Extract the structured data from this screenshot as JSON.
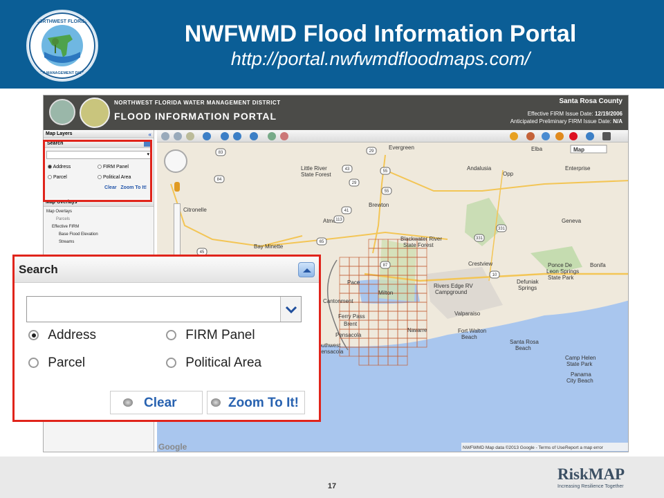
{
  "slide": {
    "title": "NWFWMD Flood Information Portal",
    "url": "http://portal.nwfwmdfloodmaps.com/",
    "page_number": "17"
  },
  "logo": {
    "text_top": "NORTHWEST FLORIDA",
    "text_bottom": "WATER MANAGEMENT DISTRICT"
  },
  "app_header": {
    "district": "NORTHWEST FLORIDA WATER MANAGEMENT DISTRICT",
    "portal": "FLOOD INFORMATION PORTAL",
    "county": "Santa Rosa County",
    "effective_label": "Effective FIRM Issue Date:",
    "effective_value": "12/19/2006",
    "anticipated_label": "Anticipated Preliminary FIRM Issue Date:",
    "anticipated_value": "N/A"
  },
  "sidebar": {
    "map_layers": "Map Layers",
    "search": "Search",
    "radio_address": "Address",
    "radio_firm": "FIRM Panel",
    "radio_parcel": "Parcel",
    "radio_political": "Political Area",
    "clear": "Clear",
    "zoom": "Zoom To It!",
    "map_overlays": "Map Overlays",
    "tree": [
      "Map Overlays",
      "Parcels",
      "Effective FIRM",
      "Base Flood Elevation",
      "Streams"
    ]
  },
  "map": {
    "type_select": "Map",
    "attribution": "NWFWMD Map data ©2013 Google - Terms of Use",
    "report": "Report a map error",
    "google": "Google",
    "labels": {
      "evergreen": "Evergreen",
      "elba": "Elba",
      "andalusia": "Andalusia",
      "opp": "Opp",
      "enterprise": "Enterprise",
      "little_river": "Little River",
      "state_forest": "State Forest",
      "brewton": "Brewton",
      "citronelle": "Citronelle",
      "atmore": "Atmore",
      "geneva": "Geneva",
      "bay_minette": "Bay Minette",
      "blackwater": "Blackwater River",
      "blackwater2": "State Forest",
      "crestview": "Crestview",
      "defuniak": "Defuniak",
      "defuniak2": "Springs",
      "ponce": "Ponce De",
      "ponce2": "Leon Springs",
      "ponce3": "State Park",
      "bonifay": "Bonifa",
      "rivers_edge": "Rivers Edge RV",
      "campground": "Campground",
      "milton": "Milton",
      "pace": "Pace",
      "cantonment": "Cantonment",
      "ferry_pass": "Ferry Pass",
      "brent": "Brent",
      "pensacola": "Pensacola",
      "southwest": "Southwest",
      "southwest2": "Pensacola",
      "valparaiso": "Valparaiso",
      "fort_walton": "Fort Walton",
      "fort_walton2": "Beach",
      "navarre": "Navarre",
      "santa_rosa": "Santa Rosa",
      "santa_rosa2": "Beach",
      "camp_helen": "Camp Helen",
      "camp_helen2": "State Park",
      "panama": "Panama",
      "panama2": "City Beach"
    },
    "routes": [
      "83",
      "29",
      "55",
      "84",
      "43",
      "41",
      "331",
      "113",
      "45",
      "65",
      "10",
      "331",
      "55",
      "29",
      "87"
    ]
  },
  "search_zoom": {
    "header": "Search",
    "address": "Address",
    "firm_panel": "FIRM Panel",
    "parcel": "Parcel",
    "political_area": "Political Area",
    "clear": "Clear",
    "zoom": "Zoom To It!"
  },
  "branding": {
    "name": "RiskMAP",
    "tagline": "Increasing Resilience Together"
  },
  "colors": {
    "header_blue": "#0b5e96",
    "highlight_red": "#e0241b",
    "grid_orange": "#c4623a"
  }
}
